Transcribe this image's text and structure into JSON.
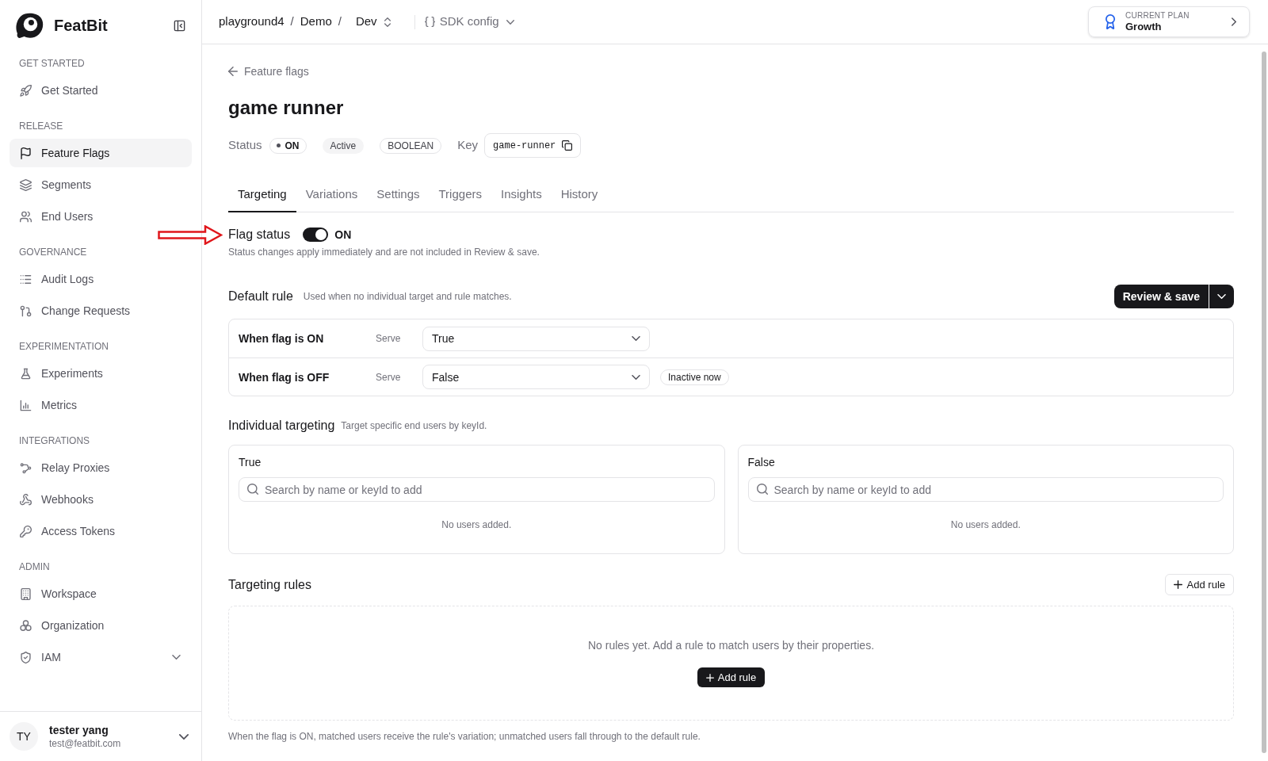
{
  "sidebar": {
    "brand": "FeatBit",
    "sections": [
      {
        "heading": "GET STARTED",
        "items": [
          {
            "label": "Get Started",
            "selected": false,
            "kind": "link"
          }
        ]
      },
      {
        "heading": "RELEASE",
        "items": [
          {
            "label": "Feature Flags",
            "selected": true,
            "kind": "link"
          },
          {
            "label": "Segments",
            "selected": false,
            "kind": "link"
          },
          {
            "label": "End Users",
            "selected": false,
            "kind": "link"
          }
        ]
      },
      {
        "heading": "GOVERNANCE",
        "items": [
          {
            "label": "Audit Logs",
            "selected": false,
            "kind": "link"
          },
          {
            "label": "Change Requests",
            "selected": false,
            "kind": "link"
          }
        ]
      },
      {
        "heading": "EXPERIMENTATION",
        "items": [
          {
            "label": "Experiments",
            "selected": false,
            "kind": "link"
          },
          {
            "label": "Metrics",
            "selected": false,
            "kind": "link"
          }
        ]
      },
      {
        "heading": "INTEGRATIONS",
        "items": [
          {
            "label": "Relay Proxies",
            "selected": false,
            "kind": "link"
          },
          {
            "label": "Webhooks",
            "selected": false,
            "kind": "link"
          },
          {
            "label": "Access Tokens",
            "selected": false,
            "kind": "link"
          }
        ]
      },
      {
        "heading": "ADMIN",
        "items": [
          {
            "label": "Workspace",
            "selected": false,
            "kind": "link"
          },
          {
            "label": "Organization",
            "selected": false,
            "kind": "link"
          },
          {
            "label": "IAM",
            "selected": false,
            "kind": "group"
          }
        ]
      }
    ],
    "user": {
      "initials": "TY",
      "name": "tester yang",
      "email": "test@featbit.com"
    }
  },
  "top_bar": {
    "breadcrumbs": [
      "playground4",
      "Demo",
      "Dev"
    ],
    "separator": "/",
    "sdk_config": "SDK config",
    "plan": {
      "caption": "CURRENT PLAN",
      "name": "Growth"
    }
  },
  "back_link": "Feature flags",
  "flag": {
    "name": "game runner",
    "status_label": "Status",
    "status": "ON",
    "state": "Active",
    "type": "BOOLEAN",
    "key_label": "Key",
    "key": "game-runner"
  },
  "tabs": [
    {
      "label": "Targeting",
      "selected": true
    },
    {
      "label": "Variations",
      "selected": false
    },
    {
      "label": "Settings",
      "selected": false
    },
    {
      "label": "Triggers",
      "selected": false
    },
    {
      "label": "Insights",
      "selected": false
    },
    {
      "label": "History",
      "selected": false
    }
  ],
  "flag_status": {
    "label": "Flag status",
    "on": true,
    "value": "ON",
    "note": "Status changes apply immediately and are not included in Review & save."
  },
  "default_rule": {
    "title": "Default rule",
    "subtitle": "Used when no individual target and rule matches.",
    "save_button": "Review & save",
    "rows": [
      {
        "label": "When flag is ON",
        "serve_label": "Serve",
        "value": "True"
      },
      {
        "label": "When flag is OFF",
        "serve_label": "Serve",
        "value": "False",
        "badge": "Inactive now"
      }
    ]
  },
  "individual_targeting": {
    "title": "Individual targeting",
    "subtitle": "Target specific end users by keyId.",
    "groups": [
      {
        "title": "True",
        "placeholder": "Search by name or keyId to add",
        "empty": "No users added."
      },
      {
        "title": "False",
        "placeholder": "Search by name or keyId to add",
        "empty": "No users added."
      }
    ]
  },
  "targeting_rules": {
    "title": "Targeting rules",
    "add_button": "Add rule",
    "empty": "No rules yet. Add a rule to match users by their properties.",
    "empty_button": "Add rule",
    "footnote": "When the flag is ON, matched users receive the rule's variation; unmatched users fall through to the default rule."
  }
}
